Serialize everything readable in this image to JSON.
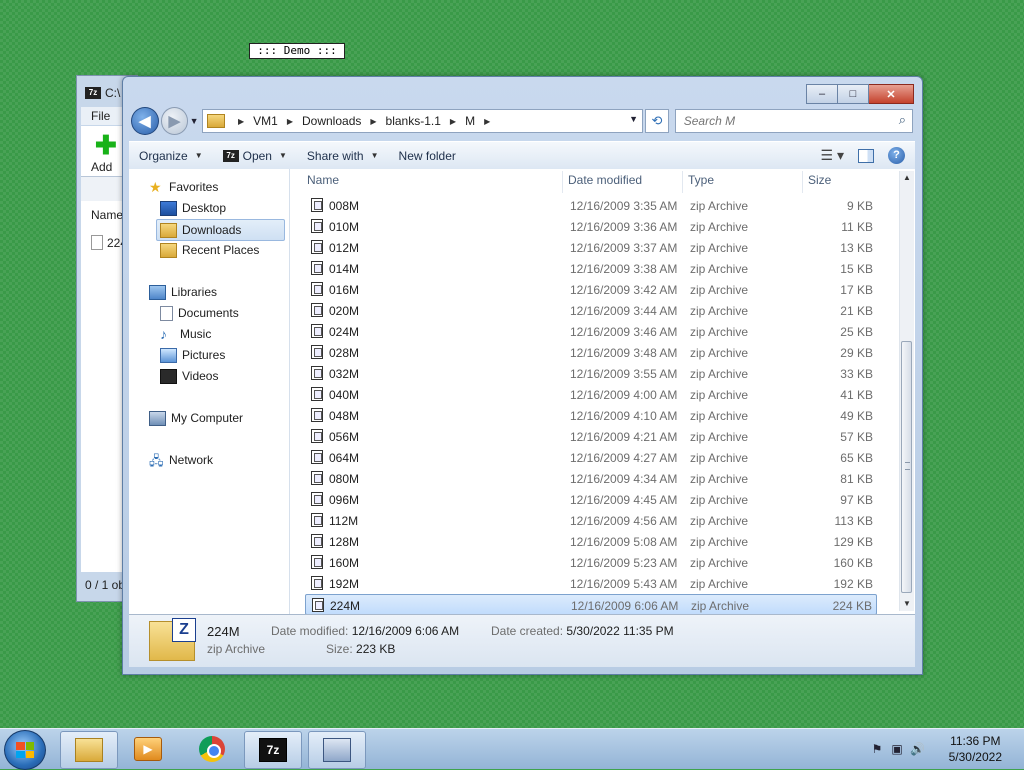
{
  "desktop": {
    "demo_label": "::: Demo :::"
  },
  "bg_window": {
    "title": "C:\\",
    "icon": "7z-icon",
    "menu_file": "File",
    "add_label": "Add",
    "list_header": "Name",
    "list_row": "224",
    "status": "0 / 1 ob"
  },
  "explorer": {
    "buttons": {
      "minimize": "–",
      "maximize": "□",
      "close": "✕"
    },
    "breadcrumbs": [
      "VM1",
      "Downloads",
      "blanks-1.1",
      "M"
    ],
    "search_placeholder": "Search M",
    "commands": {
      "organize": "Organize",
      "open": "Open",
      "share_with": "Share with",
      "new_folder": "New folder"
    },
    "nav": {
      "favorites": "Favorites",
      "desktop": "Desktop",
      "downloads": "Downloads",
      "recent_places": "Recent Places",
      "libraries": "Libraries",
      "documents": "Documents",
      "music": "Music",
      "pictures": "Pictures",
      "videos": "Videos",
      "my_computer": "My Computer",
      "network": "Network"
    },
    "columns": {
      "name": "Name",
      "date": "Date modified",
      "type": "Type",
      "size": "Size"
    },
    "files": [
      {
        "name": "008M",
        "date": "12/16/2009 3:35 AM",
        "type": "zip Archive",
        "size": "9 KB"
      },
      {
        "name": "010M",
        "date": "12/16/2009 3:36 AM",
        "type": "zip Archive",
        "size": "11 KB"
      },
      {
        "name": "012M",
        "date": "12/16/2009 3:37 AM",
        "type": "zip Archive",
        "size": "13 KB"
      },
      {
        "name": "014M",
        "date": "12/16/2009 3:38 AM",
        "type": "zip Archive",
        "size": "15 KB"
      },
      {
        "name": "016M",
        "date": "12/16/2009 3:42 AM",
        "type": "zip Archive",
        "size": "17 KB"
      },
      {
        "name": "020M",
        "date": "12/16/2009 3:44 AM",
        "type": "zip Archive",
        "size": "21 KB"
      },
      {
        "name": "024M",
        "date": "12/16/2009 3:46 AM",
        "type": "zip Archive",
        "size": "25 KB"
      },
      {
        "name": "028M",
        "date": "12/16/2009 3:48 AM",
        "type": "zip Archive",
        "size": "29 KB"
      },
      {
        "name": "032M",
        "date": "12/16/2009 3:55 AM",
        "type": "zip Archive",
        "size": "33 KB"
      },
      {
        "name": "040M",
        "date": "12/16/2009 4:00 AM",
        "type": "zip Archive",
        "size": "41 KB"
      },
      {
        "name": "048M",
        "date": "12/16/2009 4:10 AM",
        "type": "zip Archive",
        "size": "49 KB"
      },
      {
        "name": "056M",
        "date": "12/16/2009 4:21 AM",
        "type": "zip Archive",
        "size": "57 KB"
      },
      {
        "name": "064M",
        "date": "12/16/2009 4:27 AM",
        "type": "zip Archive",
        "size": "65 KB"
      },
      {
        "name": "080M",
        "date": "12/16/2009 4:34 AM",
        "type": "zip Archive",
        "size": "81 KB"
      },
      {
        "name": "096M",
        "date": "12/16/2009 4:45 AM",
        "type": "zip Archive",
        "size": "97 KB"
      },
      {
        "name": "112M",
        "date": "12/16/2009 4:56 AM",
        "type": "zip Archive",
        "size": "113 KB"
      },
      {
        "name": "128M",
        "date": "12/16/2009 5:08 AM",
        "type": "zip Archive",
        "size": "129 KB"
      },
      {
        "name": "160M",
        "date": "12/16/2009 5:23 AM",
        "type": "zip Archive",
        "size": "160 KB"
      },
      {
        "name": "192M",
        "date": "12/16/2009 5:43 AM",
        "type": "zip Archive",
        "size": "192 KB"
      },
      {
        "name": "224M",
        "date": "12/16/2009 6:06 AM",
        "type": "zip Archive",
        "size": "224 KB",
        "selected": true
      }
    ],
    "details": {
      "name": "224M",
      "type": "zip Archive",
      "date_modified_label": "Date modified:",
      "date_modified": "12/16/2009 6:06 AM",
      "date_created_label": "Date created:",
      "date_created": "5/30/2022 11:35 PM",
      "size_label": "Size:",
      "size": "223 KB"
    }
  },
  "taskbar": {
    "apps": [
      "explorer-icon",
      "media-player-icon",
      "chrome-icon",
      "7zip-icon",
      "virtualbox-icon"
    ],
    "clock_time": "11:36 PM",
    "clock_date": "5/30/2022"
  }
}
